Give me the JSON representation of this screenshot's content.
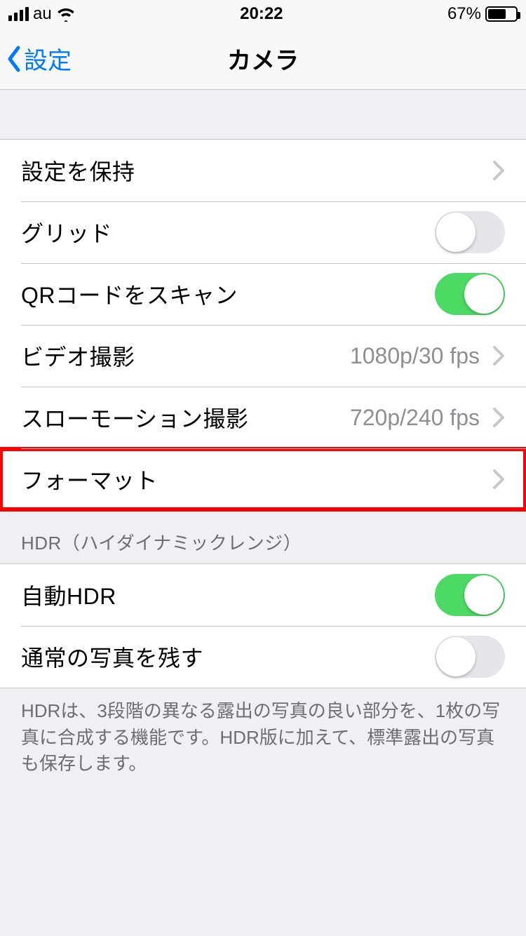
{
  "status": {
    "carrier": "au",
    "time": "20:22",
    "battery_pct": "67%",
    "battery_level": 67
  },
  "nav": {
    "back_label": "設定",
    "title": "カメラ"
  },
  "group1": {
    "preserve_settings": "設定を保持",
    "grid": "グリッド",
    "qr_scan": "QRコードをスキャン",
    "video": "ビデオ撮影",
    "video_value": "1080p/30 fps",
    "slomo": "スローモーション撮影",
    "slomo_value": "720p/240 fps",
    "format": "フォーマット"
  },
  "hdr": {
    "header": "HDR（ハイダイナミックレンジ）",
    "auto_hdr": "自動HDR",
    "keep_normal": "通常の写真を残す",
    "footer": "HDRは、3段階の異なる露出の写真の良い部分を、1枚の写真に合成する機能です。HDR版に加えて、標準露出の写真も保存します。"
  },
  "toggles": {
    "grid": false,
    "qr_scan": true,
    "auto_hdr": true,
    "keep_normal": false
  },
  "colors": {
    "accent": "#007aff",
    "switch_on": "#4cd964",
    "highlight": "#ff0000"
  }
}
